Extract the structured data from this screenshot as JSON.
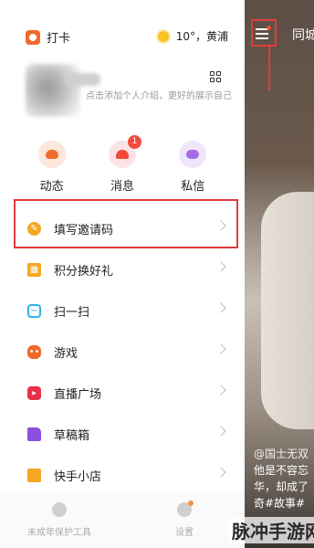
{
  "topbar": {
    "checkin_label": "打卡",
    "weather": "10°，黄浦"
  },
  "profile": {
    "bio": "点击添加个人介绍，更好的展示自己"
  },
  "quick_actions": [
    {
      "label": "动态",
      "icon": "planet-icon"
    },
    {
      "label": "消息",
      "icon": "bell-icon",
      "badge": "1"
    },
    {
      "label": "私信",
      "icon": "chat-icon"
    }
  ],
  "menu": [
    {
      "label": "填写邀请码",
      "icon": "pencil-icon",
      "color": "#f5a623"
    },
    {
      "label": "积分换好礼",
      "icon": "gift-icon",
      "color": "#f5a623"
    },
    {
      "label": "扫一扫",
      "icon": "scan-icon",
      "color": "#2bb3e8"
    },
    {
      "label": "游戏",
      "icon": "gamepad-icon",
      "color": "#f06a2c"
    },
    {
      "label": "直播广场",
      "icon": "live-icon",
      "color": "#e8304a"
    },
    {
      "label": "草稿箱",
      "icon": "folder-icon",
      "color": "#8b4fe0"
    },
    {
      "label": "快手小店",
      "icon": "shop-icon",
      "color": "#f5a623"
    }
  ],
  "bottombar": {
    "youth_label": "未成年保护工具",
    "settings_label": "设置"
  },
  "video": {
    "tab_label": "同城",
    "caption_author": "@国士无双",
    "caption_lines": [
      "他是不容忘",
      "华，却成了",
      "奇#故事#"
    ]
  },
  "watermark": "脉冲手游网",
  "colors": {
    "highlight_box": "#e23c3c",
    "badge": "#f24a3b"
  }
}
